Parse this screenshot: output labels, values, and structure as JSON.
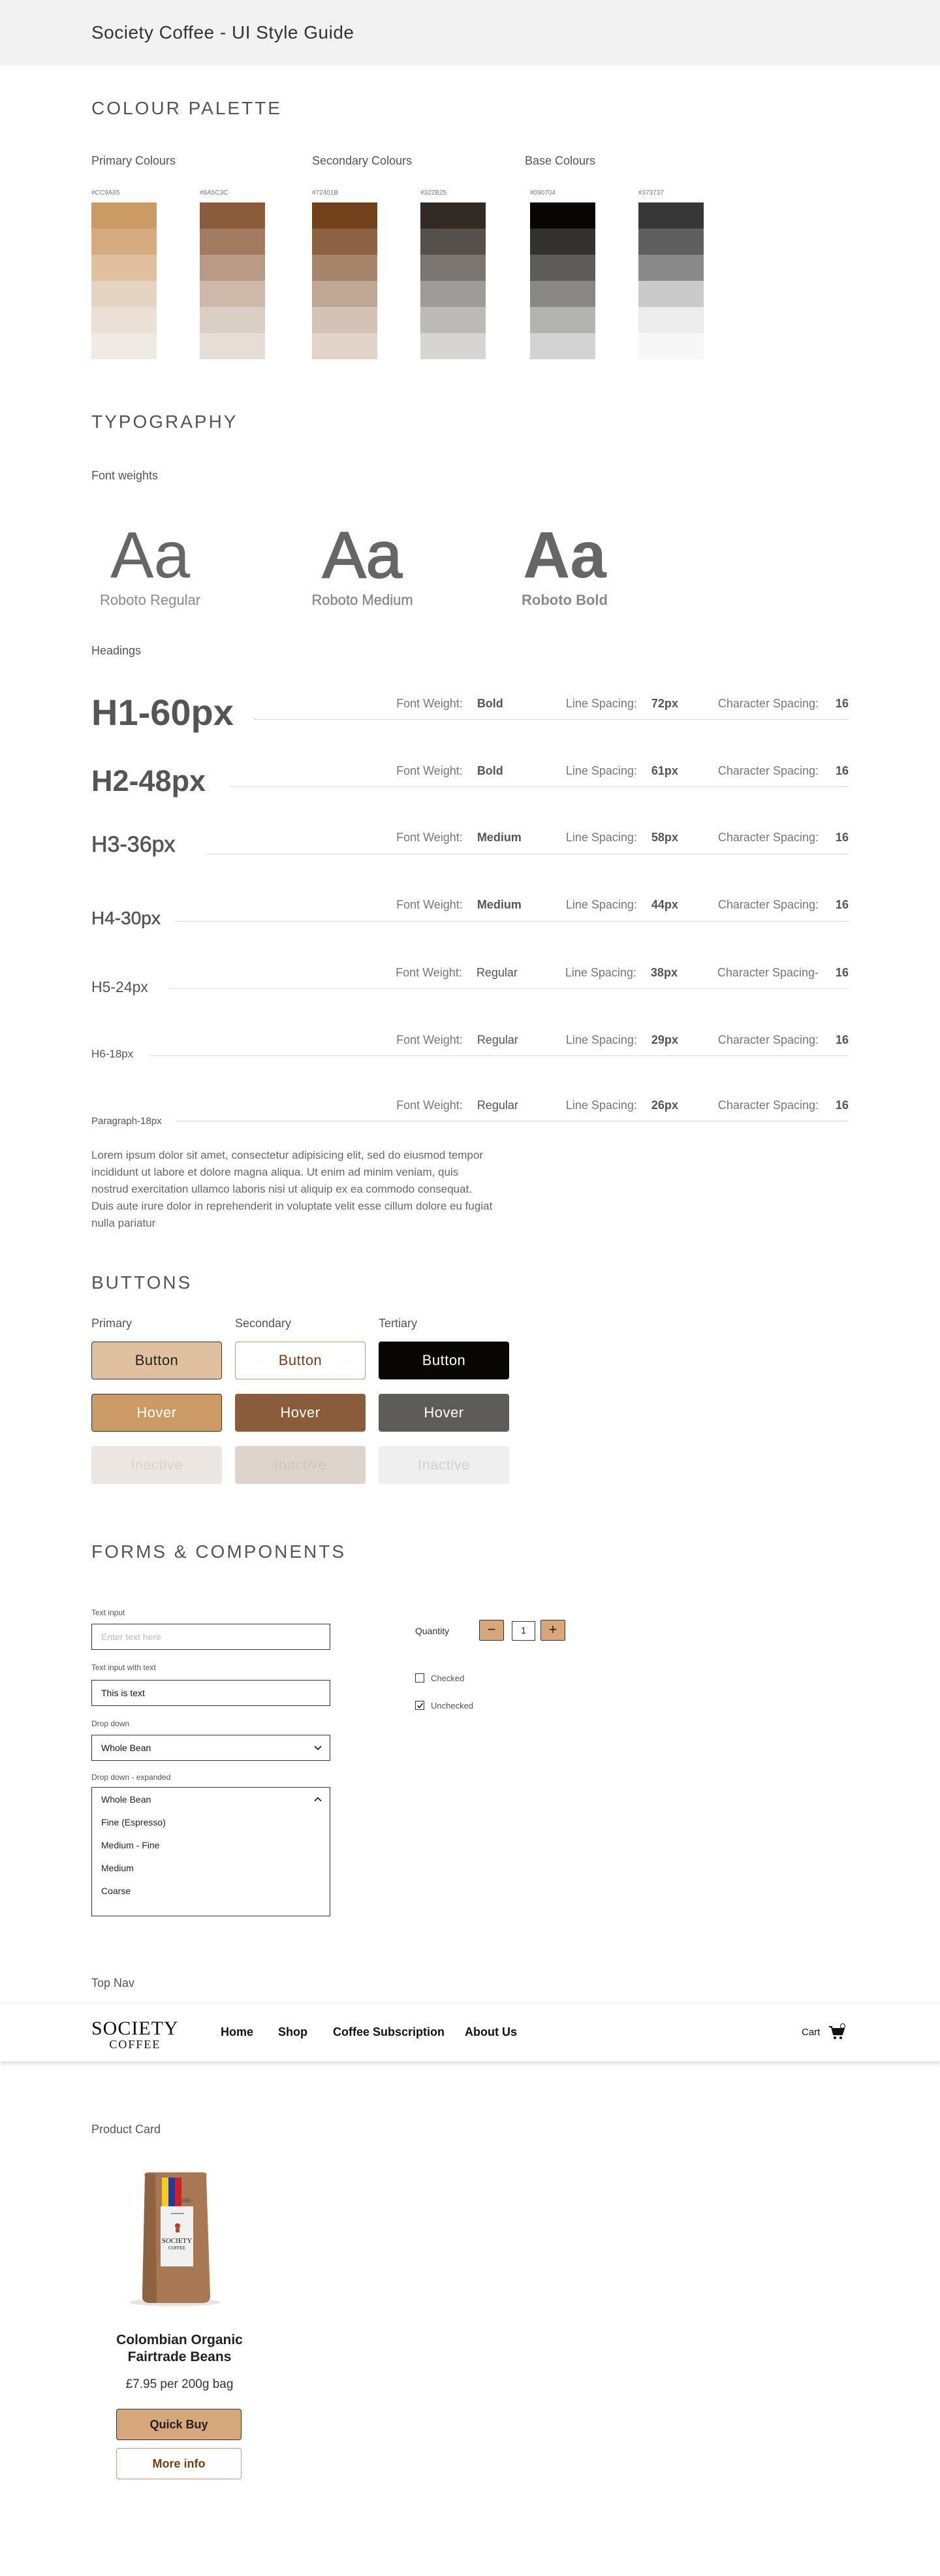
{
  "page": {
    "title": "Society Coffee - UI Style Guide"
  },
  "palette": {
    "title": "COLOUR PALETTE",
    "groups": {
      "primary": "Primary Colours",
      "secondary": "Secondary Colours",
      "base": "Base Colours"
    },
    "columns": [
      {
        "hex": "#CC9A65",
        "shades": [
          "#cc9a65",
          "#d6ab7f",
          "#e0c09f",
          "#e6d4c2",
          "#ebe0d5",
          "#efeae4"
        ]
      },
      {
        "hex": "#8A5C3C",
        "shades": [
          "#8a5c3c",
          "#a37b61",
          "#b89a86",
          "#cdb8aa",
          "#dbcec4",
          "#e6ddd6"
        ]
      },
      {
        "hex": "#72401B",
        "shades": [
          "#72401b",
          "#8d6243",
          "#a7856b",
          "#c1a895",
          "#d3c2b5",
          "#e1d4ca"
        ]
      },
      {
        "hex": "#322B25",
        "shades": [
          "#322b25",
          "#55504b",
          "#7a7571",
          "#9e9b98",
          "#bdbbb9",
          "#d6d5d4"
        ]
      },
      {
        "hex": "#090704",
        "shades": [
          "#090704",
          "#343230",
          "#5d5c5a",
          "#888786",
          "#b3b3b2",
          "#d3d3d3"
        ]
      },
      {
        "hex": "#373737",
        "shades": [
          "#373737",
          "#5f5f5f",
          "#8a8a8a",
          "#cacaca",
          "#ececec",
          "#f7f7f7"
        ]
      }
    ]
  },
  "typography": {
    "title": "TYPOGRAPHY",
    "weights_label": "Font weights",
    "samples": [
      {
        "glyph": "Aa",
        "caption": "Roboto Regular"
      },
      {
        "glyph": "Aa",
        "caption": "Roboto Medium"
      },
      {
        "glyph": "Aa",
        "caption": "Roboto Bold"
      }
    ],
    "headings_label": "Headings",
    "meta_labels": {
      "weight": "Font Weight:",
      "line": "Line Spacing:",
      "char": "Character Spacing:",
      "char_alt": "Character Spacing-"
    },
    "headings": [
      {
        "name": "H1-60px",
        "weight": "Bold",
        "line": "72px",
        "char": "16"
      },
      {
        "name": "H2-48px",
        "weight": "Bold",
        "line": "61px",
        "char": "16"
      },
      {
        "name": "H3-36px",
        "weight": "Medium",
        "line": "58px",
        "char": "16"
      },
      {
        "name": "H4-30px",
        "weight": "Medium",
        "line": "44px",
        "char": "16"
      },
      {
        "name": "H5-24px",
        "weight": "Regular",
        "line": "38px",
        "char": "16"
      },
      {
        "name": "H6-18px",
        "weight": "Regular",
        "line": "29px",
        "char": "16"
      },
      {
        "name": "Paragraph-18px",
        "weight": "Regular",
        "line": "26px",
        "char": "16"
      }
    ],
    "paragraph": "Lorem ipsum dolor sit amet, consectetur adipisicing elit, sed do eiusmod tempor incididunt ut labore et dolore magna aliqua. Ut enim ad minim veniam, quis nostrud exercitation ullamco laboris nisi ut aliquip ex ea commodo consequat. Duis aute irure dolor in reprehenderit in voluptate velit esse cillum dolore eu fugiat nulla pariatur"
  },
  "buttons": {
    "title": "BUTTONS",
    "column_labels": {
      "primary": "Primary",
      "secondary": "Secondary",
      "tertiary": "Tertiary"
    },
    "default_label": "Button",
    "hover_label": "Hover",
    "inactive_label": "Inactive"
  },
  "forms": {
    "title": "FORMS & COMPONENTS",
    "text_input_label": "Text input",
    "text_input_placeholder": "Enter text here",
    "text_input_with_text_label": "Text input with text",
    "text_input_value": "This is text",
    "dropdown_label": "Drop down",
    "dropdown_value": "Whole Bean",
    "dropdown_expanded_label": "Drop down - expanded",
    "dropdown_options": [
      "Whole Bean",
      "Fine (Espresso)",
      "Medium - Fine",
      "Medium",
      "Coarse"
    ],
    "quantity_label": "Quantity",
    "quantity_minus": "−",
    "quantity_value": "1",
    "quantity_plus": "+",
    "checkbox_1": "Checked",
    "checkbox_2": "Unchecked"
  },
  "nav": {
    "section_label": "Top Nav",
    "logo_line1": "SOCIETY",
    "logo_line2": "COFFEE",
    "links": [
      "Home",
      "Shop",
      "Coffee Subscription",
      "About Us"
    ],
    "cart_label": "Cart"
  },
  "product": {
    "section_label": "Product Card",
    "bag_brand_line1": "SOCIETY",
    "bag_brand_line2": "COFFEE",
    "name": "Colombian Organic Fairtrade Beans",
    "price": "£7.95 per 200g bag",
    "quick_buy": "Quick Buy",
    "more_info": "More info"
  },
  "colors": {
    "primary": "#cc9a65",
    "primary_light": "#e0c09f",
    "secondary": "#8a5c3c",
    "secondary_text": "#72401b",
    "dark": "#090704",
    "dark_hover": "#5d5c5a"
  }
}
